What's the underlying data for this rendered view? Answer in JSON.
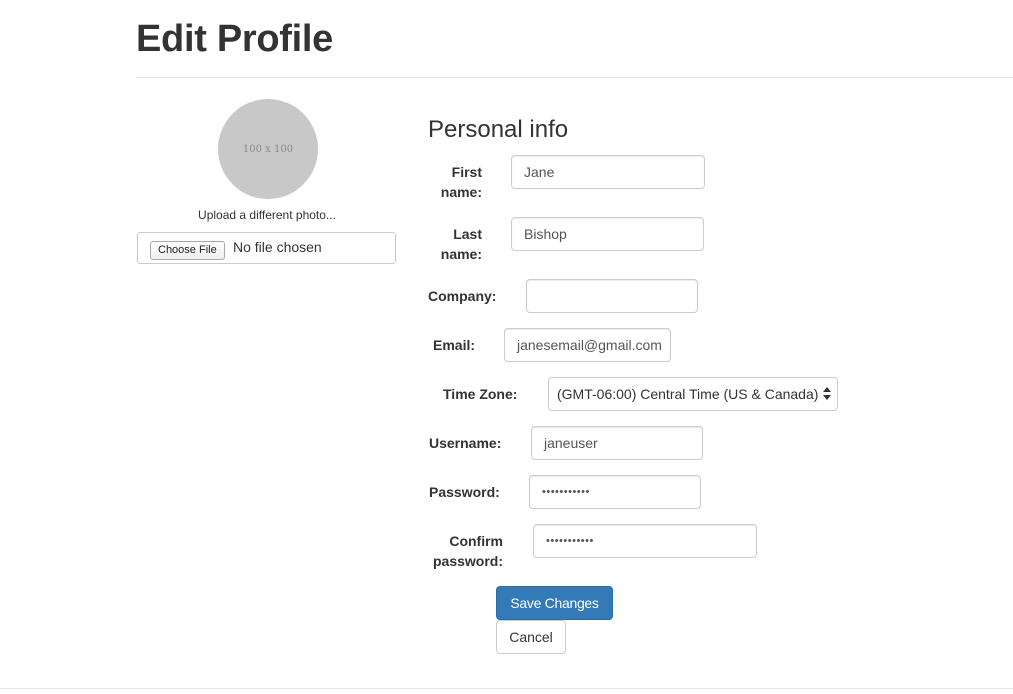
{
  "page": {
    "title": "Edit Profile"
  },
  "photo": {
    "placeholder_text": "100 x 100",
    "upload_label": "Upload a different photo...",
    "choose_file_label": "Choose File",
    "file_status": "No file chosen"
  },
  "form": {
    "section_title": "Personal info",
    "first_name": {
      "label_line1": "First",
      "label_line2": "name:",
      "value": "Jane"
    },
    "last_name": {
      "label_line1": "Last",
      "label_line2": "name:",
      "value": "Bishop"
    },
    "company": {
      "label": "Company:",
      "value": ""
    },
    "email": {
      "label": "Email:",
      "value": "janesemail@gmail.com"
    },
    "time_zone": {
      "label": "Time Zone:",
      "value": "(GMT-06:00) Central Time (US & Canada)"
    },
    "username": {
      "label": "Username:",
      "value": "janeuser"
    },
    "password": {
      "label": "Password:",
      "value": "•••••••••••"
    },
    "confirm_password": {
      "label_line1": "Confirm",
      "label_line2": "password:",
      "value": "•••••••••••"
    },
    "save_label": "Save Changes",
    "cancel_label": "Cancel"
  },
  "colors": {
    "primary": "#337ab7",
    "border": "#cccccc",
    "avatar": "#c8c8c8"
  }
}
